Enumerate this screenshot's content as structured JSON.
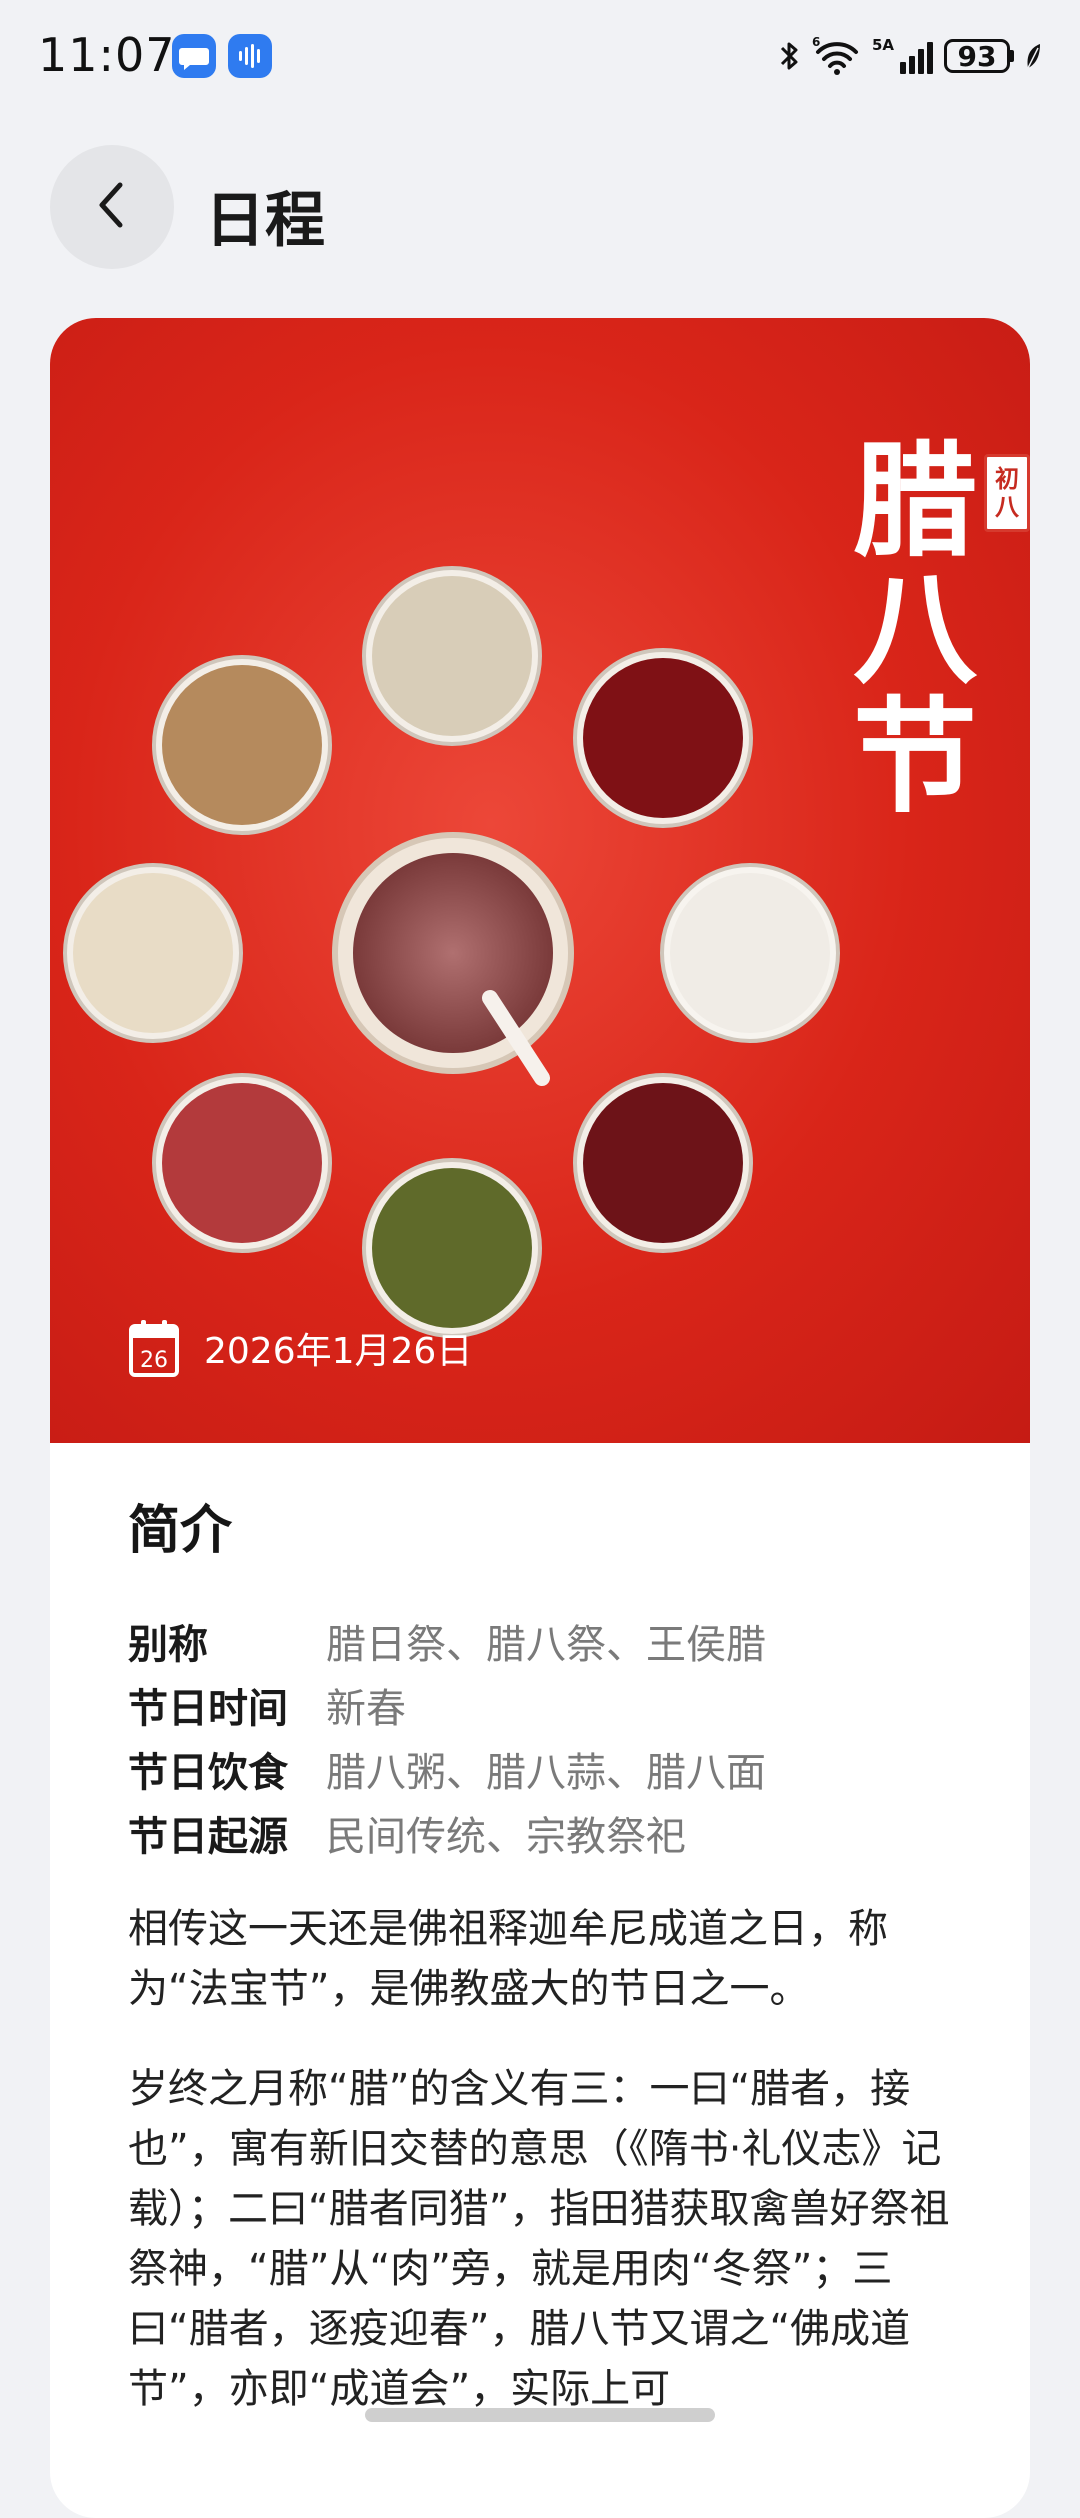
{
  "status_bar": {
    "time": "11:07",
    "network_label": "5A",
    "battery": "93"
  },
  "header": {
    "title": "日程"
  },
  "hero": {
    "festival_chars": [
      "腊",
      "八",
      "节"
    ],
    "lunar_chars": [
      "初",
      "八"
    ],
    "calendar_day": "26",
    "date": "2026年1月26日",
    "colors": {
      "background": "#d92519",
      "text": "#ffffff"
    }
  },
  "intro": {
    "title": "简介",
    "fields": [
      {
        "label": "别称",
        "value": "腊日祭、腊八祭、王侯腊"
      },
      {
        "label": "节日时间",
        "value": "新春"
      },
      {
        "label": "节日饮食",
        "value": "腊八粥、腊八蒜、腊八面"
      },
      {
        "label": "节日起源",
        "value": "民间传统、宗教祭祀"
      }
    ],
    "paragraphs": [
      "相传这一天还是佛祖释迦牟尼成道之日，称为“法宝节”，是佛教盛大的节日之一。",
      "岁终之月称“腊”的含义有三：一曰“腊者，接也”，寓有新旧交替的意思（《隋书·礼仪志》记载）；二曰“腊者同猎”，指田猎获取禽兽好祭祖祭神，“腊”从“肉”旁，就是用肉“冬祭”；三曰“腊者，逐疫迎春”，腊八节又谓之“佛成道节”，亦即“成道会”，实际上可"
    ]
  },
  "icons": {
    "back": "chevron-left-icon",
    "calendar": "calendar-icon",
    "bluetooth": "bluetooth-icon",
    "wifi": "wifi-icon",
    "signal": "signal-icon",
    "battery": "battery-icon",
    "leaf": "leaf-icon"
  }
}
